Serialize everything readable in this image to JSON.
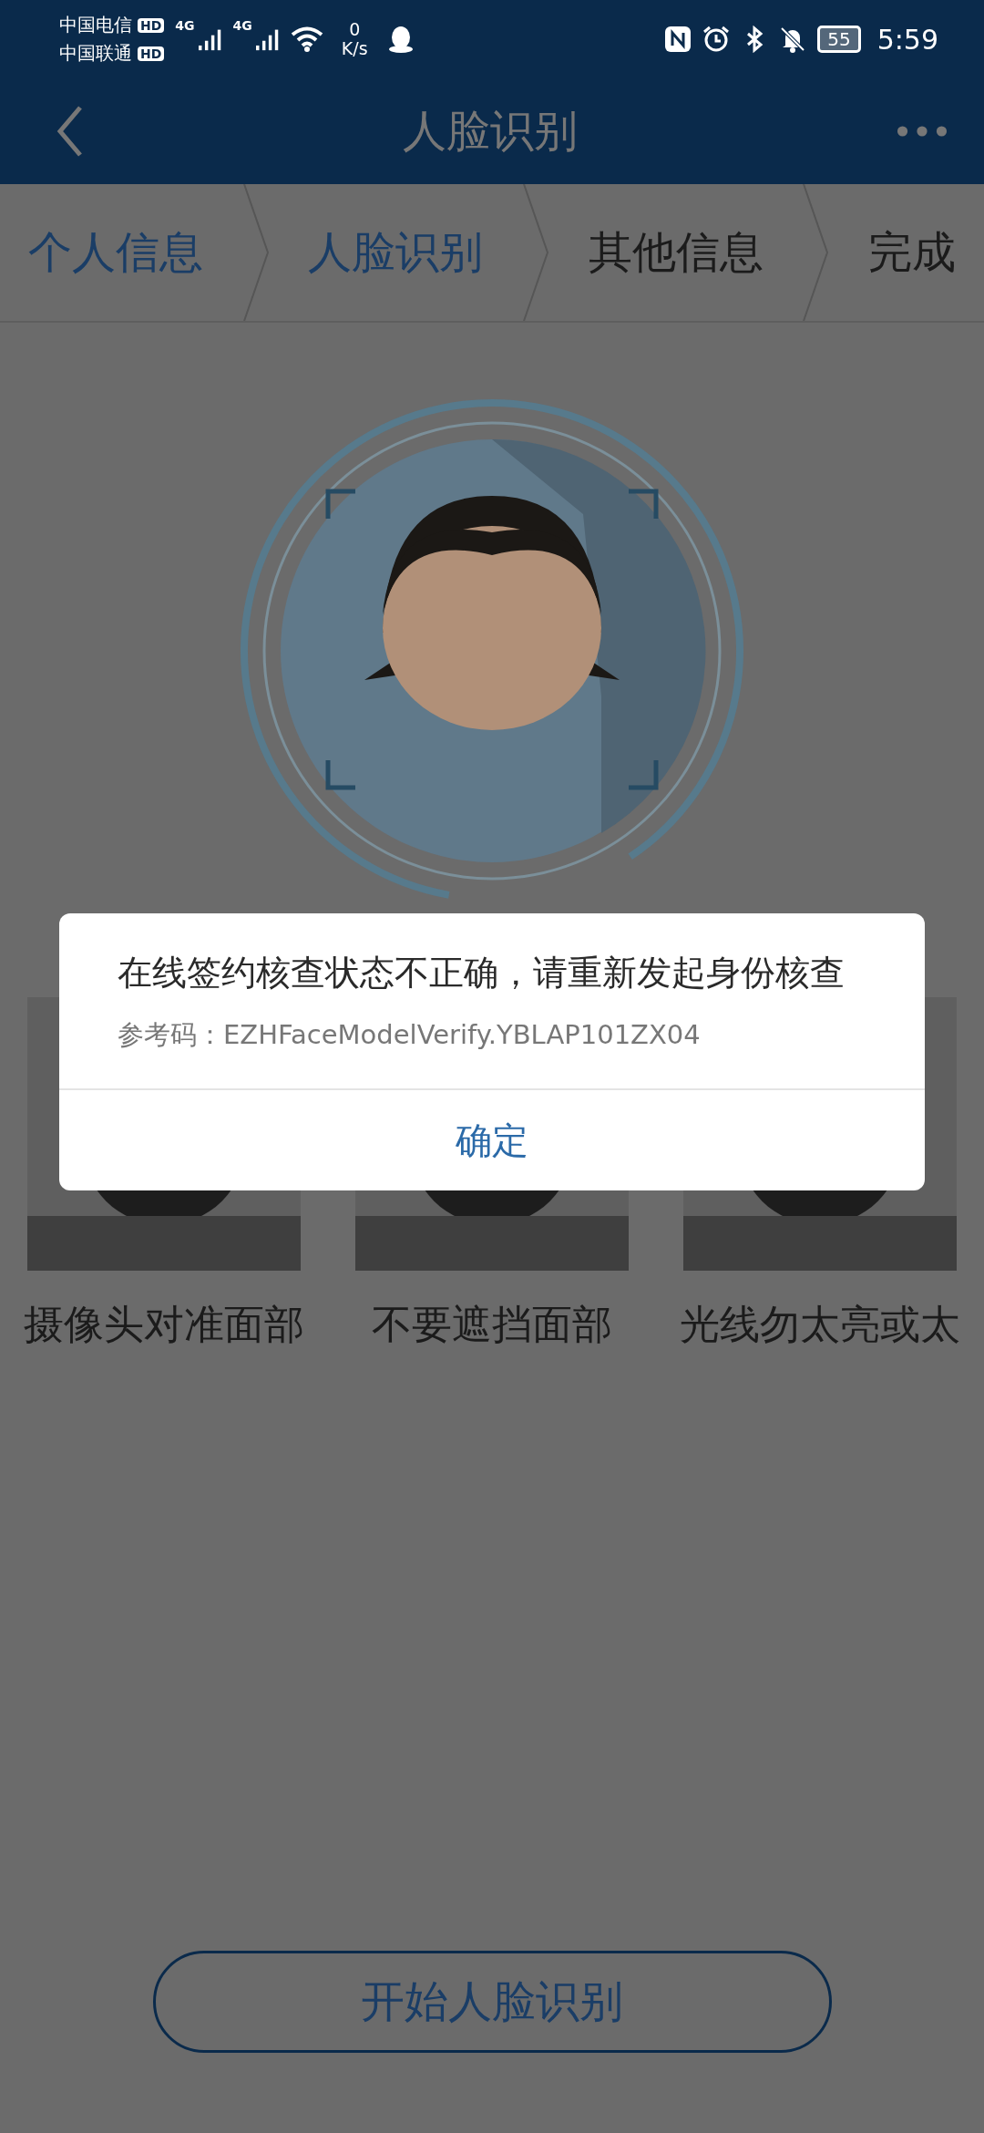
{
  "status_bar": {
    "carrier_1": "中国电信",
    "carrier_2": "中国联通",
    "hd_1": "HD",
    "hd_2": "HD",
    "net_1": "4G",
    "net_2": "4G",
    "speed_value": "0",
    "speed_unit": "K/s",
    "battery": "55",
    "time": "5:59"
  },
  "header": {
    "title": "人脸识别"
  },
  "steps": [
    {
      "label": "个人信息",
      "done": true
    },
    {
      "label": "人脸识别",
      "done": true
    },
    {
      "label": "其他信息",
      "done": false
    },
    {
      "label": "完成",
      "done": false
    }
  ],
  "tips": [
    {
      "caption": "摄像头对准面部"
    },
    {
      "caption": "不要遮挡面部"
    },
    {
      "caption": "光线勿太亮或太"
    }
  ],
  "dialog": {
    "message": "在线签约核查状态不正确，请重新发起身份核查",
    "reference_label": "参考码：",
    "reference_code": "EZHFaceModelVerify.YBLAP101ZX04",
    "ok": "确定"
  },
  "start_button": "开始人脸识别"
}
